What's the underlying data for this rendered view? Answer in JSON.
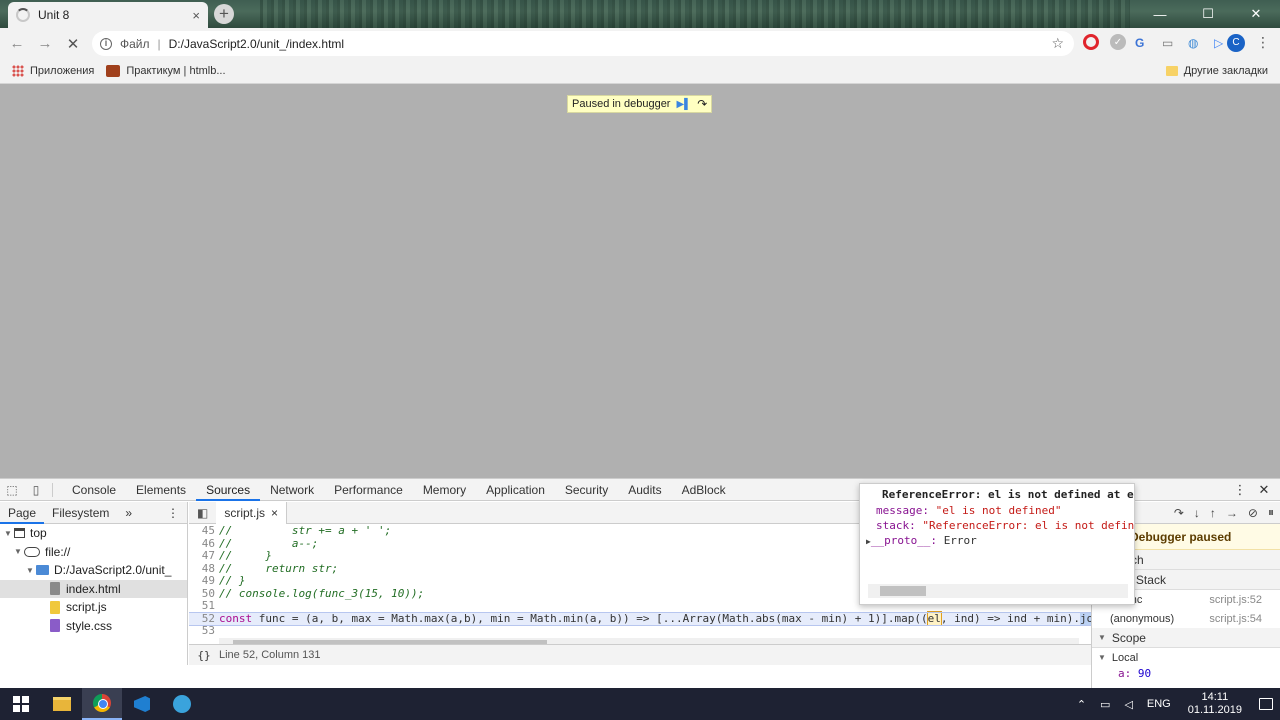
{
  "browser": {
    "tab_title": "Unit 8",
    "tab_close": "×",
    "new_tab": "+",
    "window_controls": [
      "—",
      "☐",
      "✕"
    ],
    "address_scheme": "Файл",
    "address_separator": "|",
    "address_url": "D:/JavaScript2.0/unit_/index.html",
    "bookmarks": [
      {
        "label": "Приложения",
        "icon": "apps-icon"
      },
      {
        "label": "Практикум | htmlb...",
        "icon": "praktikum-icon"
      }
    ],
    "other_bookmarks": "Другие закладки",
    "avatar_letter": "C"
  },
  "page": {
    "debug_banner": "Paused in debugger"
  },
  "devtools": {
    "tabs": [
      "Console",
      "Elements",
      "Sources",
      "Network",
      "Performance",
      "Memory",
      "Application",
      "Security",
      "Audits",
      "AdBlock"
    ],
    "active_tab": "Sources",
    "navigator_tabs": [
      "Page",
      "Filesystem",
      "»"
    ],
    "tree": {
      "top": "top",
      "origin": "file://",
      "folder": "D:/JavaScript2.0/unit_",
      "files": [
        "index.html",
        "script.js",
        "style.css"
      ]
    },
    "editor_tab": "script.js",
    "editor_tab_close": "×",
    "status": "Line 52, Column 131",
    "pretty_print": "{}",
    "debugger": {
      "paused": "Debugger paused",
      "sections": {
        "call_stack": "Call Stack",
        "scope": "Scope",
        "local": "Local"
      },
      "frames": [
        {
          "name": "func",
          "loc": "script.js:52"
        },
        {
          "name": "(anonymous)",
          "loc": "script.js:54"
        }
      ],
      "local_var_key": "a:",
      "local_var_value": "90"
    },
    "error_popover": {
      "title": "ReferenceError: el is not defined at ev…",
      "message_key": "message:",
      "message_val": "\"el is not defined\"",
      "stack_key": "stack:",
      "stack_val": "\"ReferenceError: el is not defined↵",
      "proto_key": "__proto__:",
      "proto_val": "Error"
    }
  },
  "taskbar": {
    "lang": "ENG",
    "time": "14:11",
    "date": "01.11.2019"
  },
  "colors": {
    "accent": "#1a73e8",
    "banner_bg": "#ffffc2",
    "page_overlay": "#b0b0b0"
  }
}
